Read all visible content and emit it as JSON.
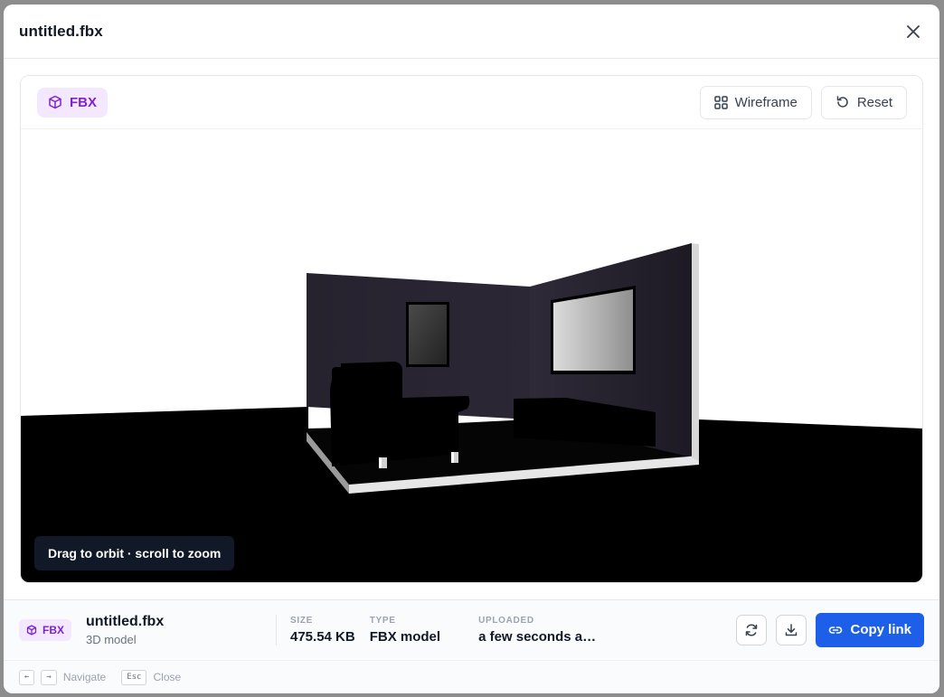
{
  "modal": {
    "title": "untitled.fbx"
  },
  "viewer": {
    "format_badge": "FBX",
    "wireframe_label": "Wireframe",
    "reset_label": "Reset",
    "hint": "Drag to orbit · scroll to zoom"
  },
  "footer": {
    "badge": "FBX",
    "file_name": "untitled.fbx",
    "file_kind": "3D model",
    "size_label": "SIZE",
    "size_value": "475.54 KB",
    "type_label": "TYPE",
    "type_value": "FBX model",
    "uploaded_label": "UPLOADED",
    "uploaded_value": "a few seconds a…",
    "copy_link_label": "Copy link"
  },
  "shortcuts": {
    "prev_key": "←",
    "next_key": "→",
    "navigate_label": "Navigate",
    "esc_key": "Esc",
    "close_label": "Close"
  },
  "colors": {
    "accent": "#1d5fe8",
    "badge_bg": "#f3e8ff",
    "badge_fg": "#7e22ce"
  },
  "icons": [
    "close-icon",
    "cube-icon",
    "grid-icon",
    "reset-icon",
    "refresh-icon",
    "download-icon",
    "link-icon"
  ]
}
